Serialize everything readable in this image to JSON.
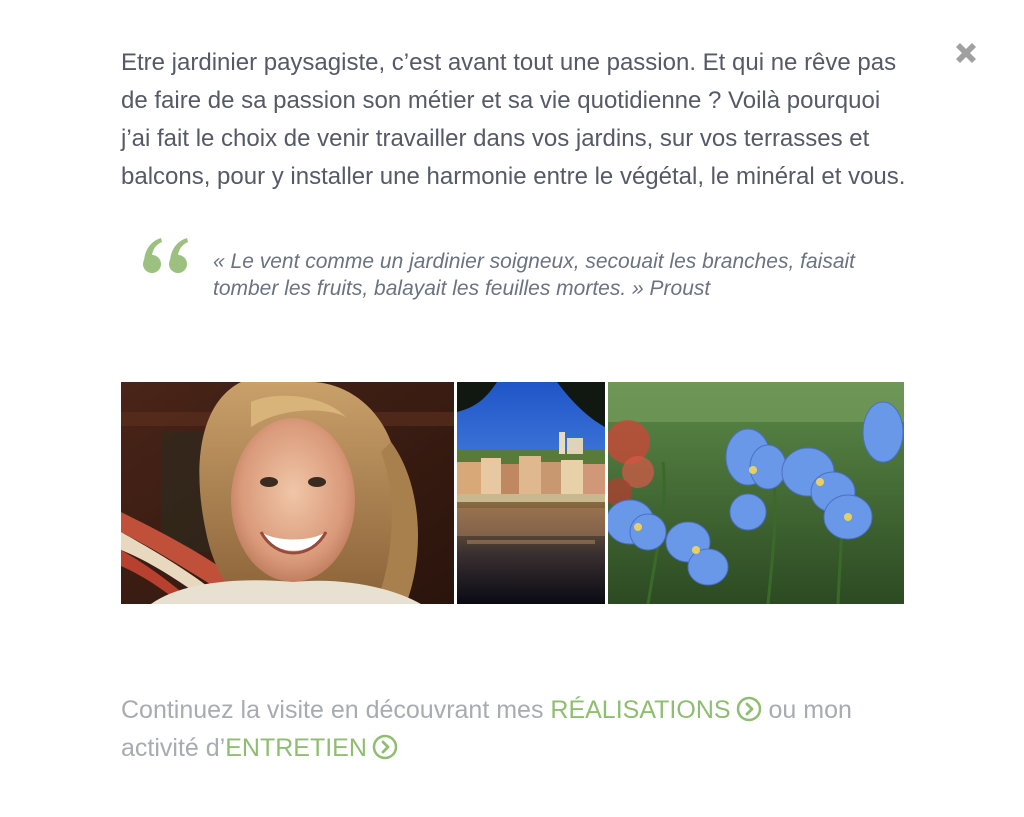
{
  "intro": {
    "text": "Etre jardinier paysagiste, c’est avant tout une passion. Et qui ne rêve pas de faire de sa passion son métier et sa vie quotidienne ? Voilà pourquoi j’ai fait le choix de venir travailler dans vos jardins, sur vos terrasses et balcons, pour y installer une harmonie entre le végétal, le minéral et vous."
  },
  "quote": {
    "text": "« Le vent comme un jardinier soigneux, secouait les branches, faisait tomber les fruits, balayait les feuilles mortes. » Proust"
  },
  "footer": {
    "before": "Continuez la visite en découvrant mes ",
    "link1": "RÉALISATIONS",
    "middle": " ou mon activité d’",
    "link2": "ENTRETIEN"
  },
  "icons": {
    "close": "close-icon",
    "quote": "quote-icon",
    "arrow": "circle-chevron-right-icon"
  },
  "colors": {
    "accent_green": "#8fbd72",
    "quote_green": "#9cc07f",
    "body_text": "#555a66",
    "muted_text": "#a8abb1",
    "close_grey": "#a0a0a0"
  }
}
